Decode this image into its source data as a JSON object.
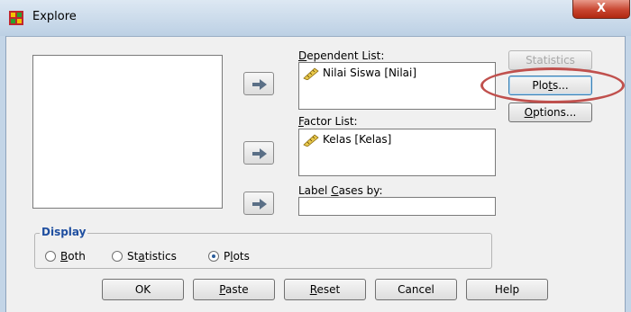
{
  "window": {
    "title": "Explore",
    "close_label": "X"
  },
  "variables_list": {
    "items": []
  },
  "dependent_list": {
    "label_prefix": "",
    "label_accel": "D",
    "label_rest": "ependent List:",
    "items": [
      "Nilai Siswa [Nilai]"
    ]
  },
  "factor_list": {
    "label_accel": "F",
    "label_rest": "actor List:",
    "items": [
      "Kelas [Kelas]"
    ]
  },
  "label_cases": {
    "label_before": "Label ",
    "label_accel": "C",
    "label_rest": "ases by:",
    "value": ""
  },
  "side_buttons": {
    "statistics": "Statistics",
    "plots_before": "Plo",
    "plots_accel": "t",
    "plots_rest": "s...",
    "options_accel": "O",
    "options_rest": "ptions..."
  },
  "display": {
    "title": "Display",
    "options": [
      {
        "accel": "B",
        "rest": "oth",
        "before": "",
        "selected": false
      },
      {
        "before": "St",
        "accel": "a",
        "rest": "tistics",
        "selected": false
      },
      {
        "before": "P",
        "accel": "l",
        "rest": "ots",
        "selected": true
      }
    ]
  },
  "bottom_buttons": {
    "ok": "OK",
    "paste_accel": "P",
    "paste_rest": "aste",
    "reset_accel": "R",
    "reset_rest": "eset",
    "cancel": "Cancel",
    "help": "Help"
  },
  "colors": {
    "highlight_ring": "#c0504d",
    "group_title": "#1f4fa0"
  }
}
